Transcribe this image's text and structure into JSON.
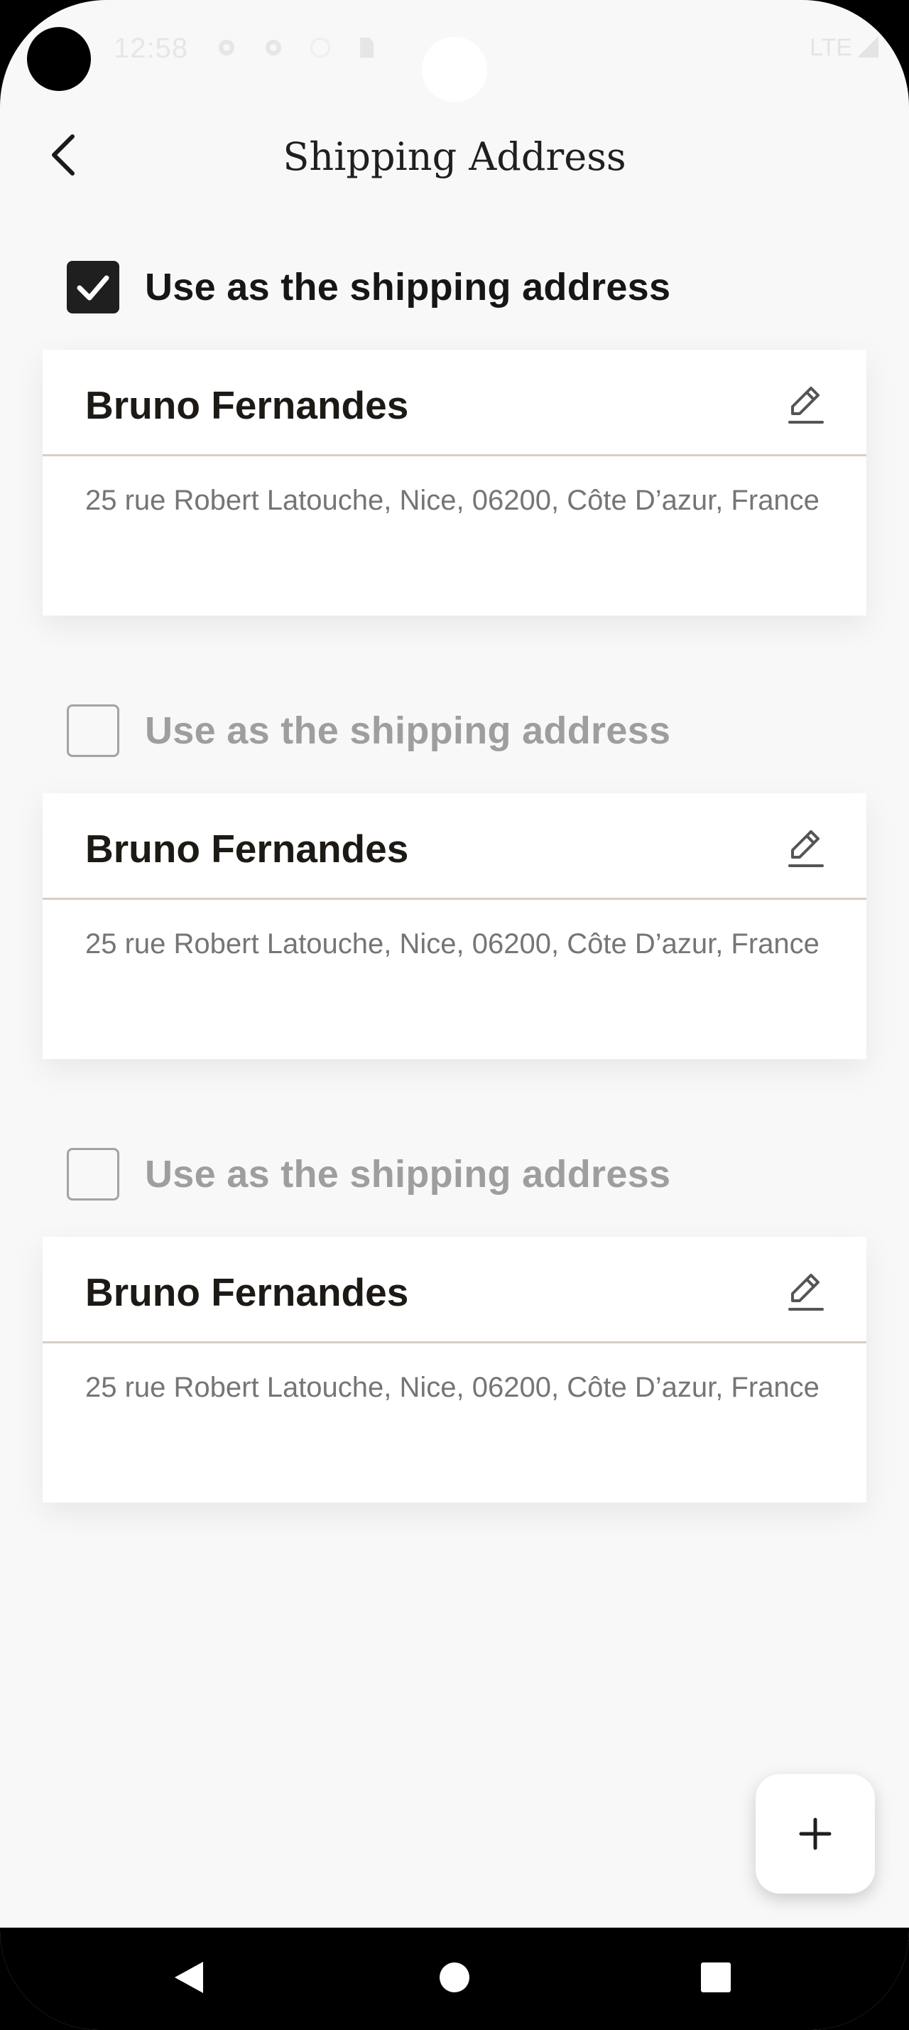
{
  "status_bar": {
    "time": "12:58",
    "network": "LTE"
  },
  "header": {
    "title": "Shipping Address"
  },
  "addresses": [
    {
      "checkbox_label": "Use as the shipping address",
      "checked": true,
      "name": "Bruno Fernandes",
      "address": "25 rue Robert Latouche, Nice, 06200, Côte D’azur, France"
    },
    {
      "checkbox_label": "Use as the shipping address",
      "checked": false,
      "name": "Bruno Fernandes",
      "address": "25 rue Robert Latouche, Nice, 06200, Côte D’azur, France"
    },
    {
      "checkbox_label": "Use as the shipping address",
      "checked": false,
      "name": "Bruno Fernandes",
      "address": "25 rue Robert Latouche, Nice, 06200, Côte D’azur, France"
    }
  ],
  "icons": {
    "back": "chevron-left-icon",
    "edit": "pencil-icon",
    "add": "plus-icon",
    "check": "checkmark-icon",
    "nav_back": "triangle-back-icon",
    "nav_home": "circle-home-icon",
    "nav_recents": "square-recents-icon"
  },
  "colors": {
    "background": "#f8f8f8",
    "card": "#ffffff",
    "divider": "#d8cfc2",
    "checked_box": "#1f1f1f",
    "inactive_text": "#9e9e9e",
    "address_text": "#757575"
  }
}
